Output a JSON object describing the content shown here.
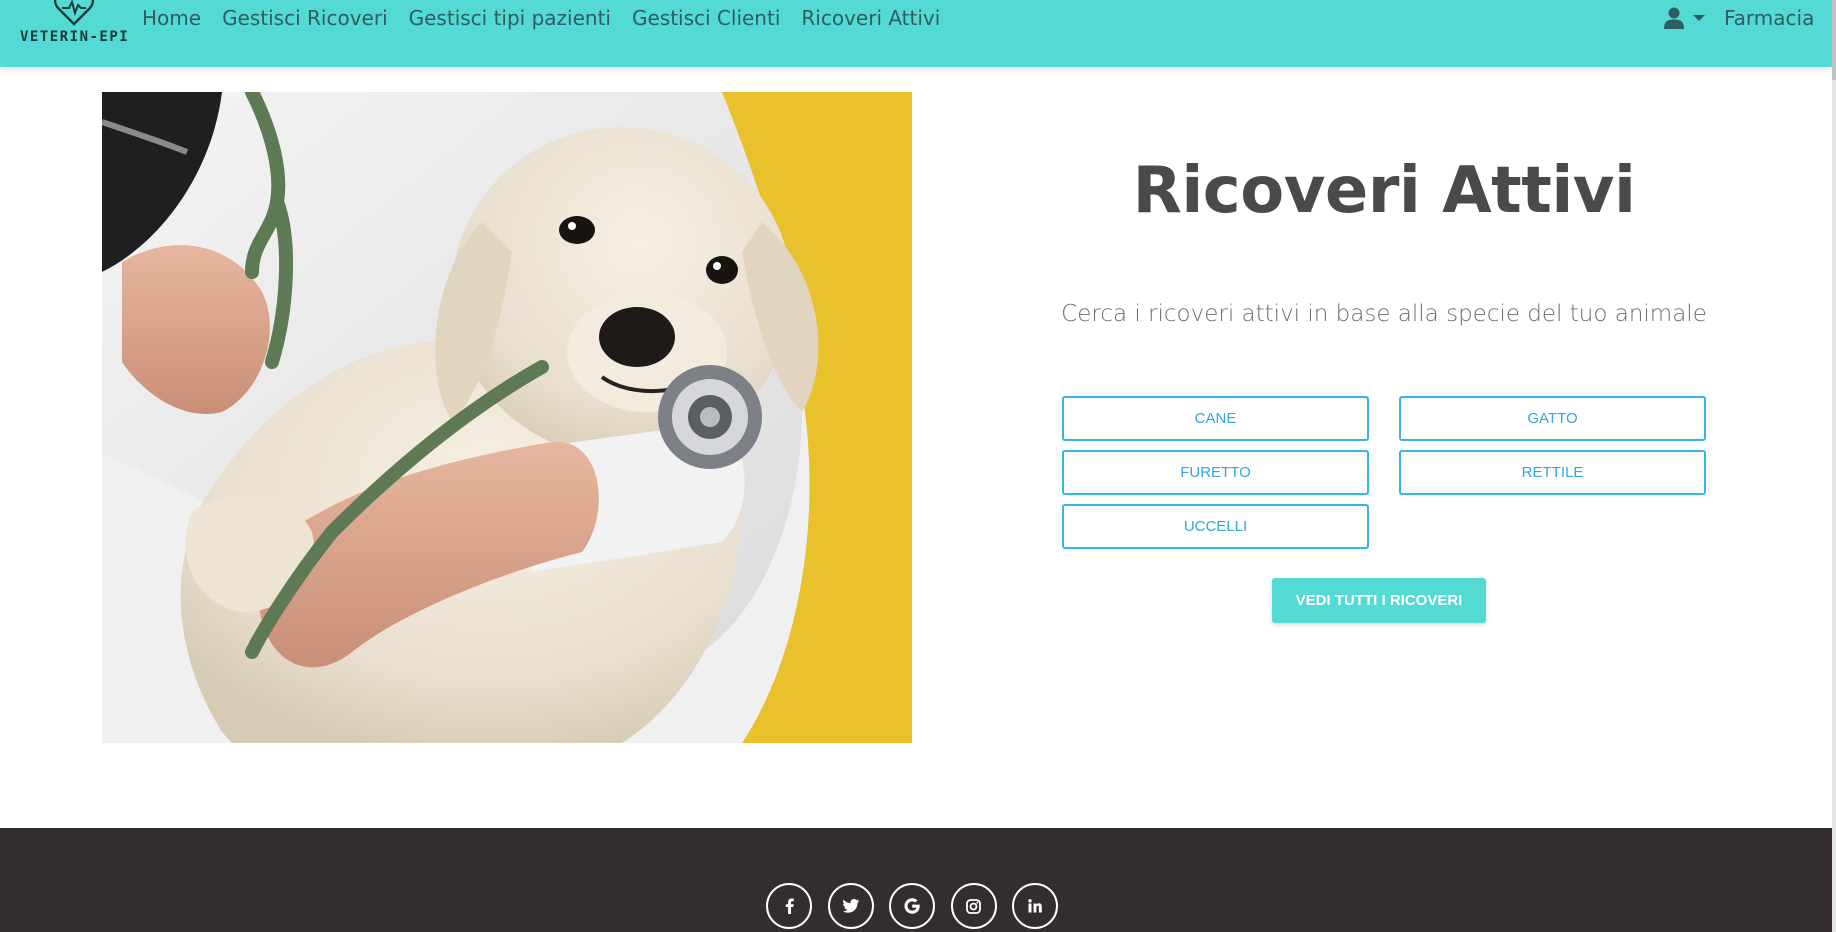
{
  "navbar": {
    "brand": "VETERIN-EPI",
    "links": [
      "Home",
      "Gestisci Ricoveri",
      "Gestisci tipi pazienti",
      "Gestisci Clienti",
      "Ricoveri Attivi"
    ],
    "user_icon": "user-icon",
    "dropdown_icon": "caret-down-icon",
    "right_link": "Farmacia",
    "background": "#53dad4"
  },
  "main": {
    "title": "Ricoveri Attivi",
    "subtitle": "Cerca i ricoveri attivi in base alla specie del tuo animale",
    "species": [
      "Cane",
      "Gatto",
      "Furetto",
      "Rettile",
      "Uccelli"
    ],
    "view_all": "VEDI TUTTI I RICOVERI",
    "accent": "#33b5e5"
  },
  "footer": {
    "social_icons": [
      "facebook-icon",
      "twitter-icon",
      "google-icon",
      "instagram-icon",
      "linkedin-icon"
    ],
    "background": "#332d2e"
  }
}
